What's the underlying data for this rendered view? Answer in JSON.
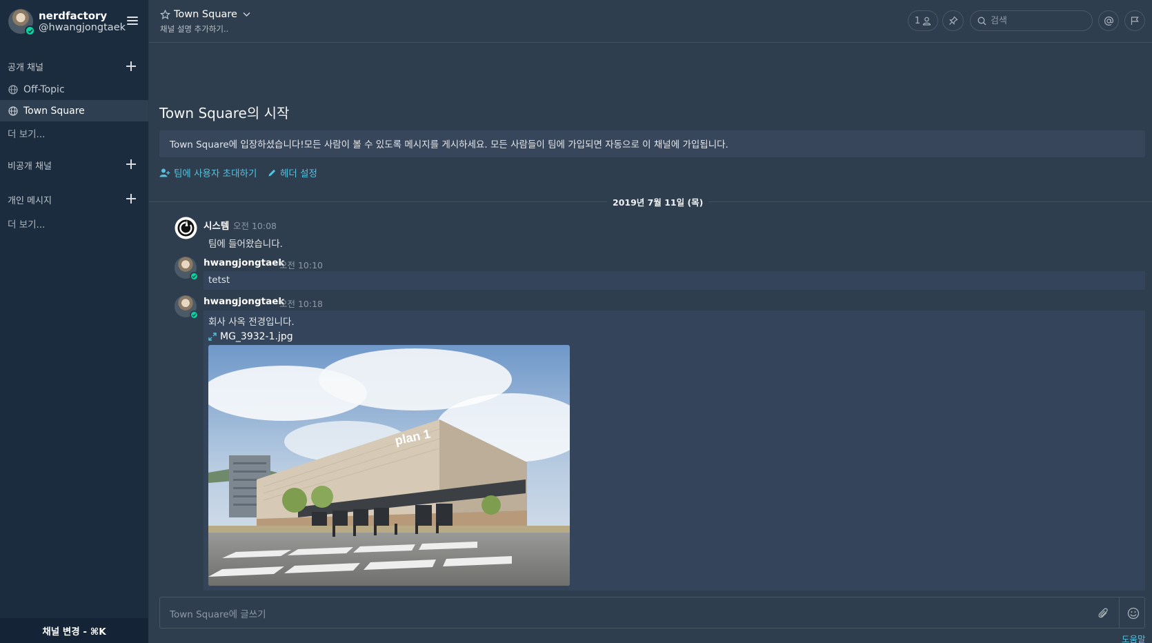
{
  "sidebar": {
    "team_name": "nerdfactory",
    "username": "@hwangjongtaek",
    "sections": {
      "public": "공개 채널",
      "private": "비공개 채널",
      "direct": "개인 메시지"
    },
    "public_channels": [
      {
        "label": "Off-Topic",
        "icon": "globe-icon"
      },
      {
        "label": "Town Square",
        "icon": "globe-icon",
        "active": true
      }
    ],
    "more_public": "더 보기...",
    "more_direct": "더 보기...",
    "switch_channel": "채널 변경 - ⌘K"
  },
  "header": {
    "channel_name": "Town Square",
    "channel_desc": "채널 설명 추가하기..",
    "member_count": "1",
    "search_placeholder": "검색"
  },
  "intro": {
    "title": "Town Square의 시작",
    "text": "Town Square에 입장하셨습니다!모든 사람이 볼 수 있도록 메시지를 게시하세요. 모든 사람들이 팀에 가입되면 자동으로 이 채널에 가입됩니다.",
    "invite_label": "팀에 사용자 초대하기",
    "header_label": "헤더 설정"
  },
  "date_separator": "2019년 7월 11일 (목)",
  "posts": [
    {
      "author": "시스템",
      "time": "오전 10:08",
      "text": "팀에 들어왔습니다."
    },
    {
      "author": "hwangjongtaek",
      "time": "오전 10:10",
      "text": "tetst"
    },
    {
      "author": "hwangjongtaek",
      "time": "오전 10:18",
      "text": "회사 사옥 전경입니다.",
      "attachment": "MG_3932-1.jpg",
      "photo_sign": "plan 1"
    }
  ],
  "composer": {
    "placeholder": "Town Square에 글쓰기",
    "help_label": "도움말"
  },
  "colors": {
    "sidebar_bg": "#1b2c3e",
    "main_bg": "#2f3e4e",
    "link": "#55c1df",
    "online": "#06d6a0"
  }
}
